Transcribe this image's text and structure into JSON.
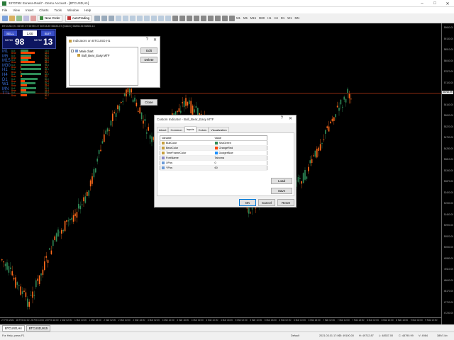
{
  "window": {
    "title": "3370795: Exness-Real7 - Demo Account - [BTCUSD,H1]"
  },
  "menu": [
    "File",
    "View",
    "Insert",
    "Charts",
    "Tools",
    "Window",
    "Help"
  ],
  "toolbar": {
    "new_order": "New Order",
    "autotrading": "AutoTrading",
    "timeframes": [
      "M1",
      "M5",
      "M15",
      "M30",
      "H1",
      "H4",
      "D1",
      "W1",
      "MN"
    ]
  },
  "chart": {
    "info": "BTCUSD,H1  56787.07 55789.27 56733.89 56833.67 (hidden) 56836.36 56806.13",
    "one_click": {
      "sell": "SELL",
      "buy": "BUY",
      "lot": "1.00",
      "sell_prefix": "56760",
      "sell_big": "98",
      "buy_prefix": "56762",
      "buy_big": "13"
    },
    "mtf": [
      {
        "tf": "M1",
        "bull": "35.0 %",
        "bear": "65.0 %"
      },
      {
        "tf": "M5",
        "bull": "50.0 %",
        "bear": "50.0 %"
      },
      {
        "tf": "M15",
        "bull": "35.0 %",
        "bear": "65.0 %"
      },
      {
        "tf": "M30",
        "bull": "95.4 %",
        "bear": "4.6 %"
      },
      {
        "tf": "H1",
        "bull": "96.1 %",
        "bear": "3.9 %"
      },
      {
        "tf": "H4",
        "bull": "95.0 %",
        "bear": "5.0 %"
      },
      {
        "tf": "D1",
        "bull": "80.0 %",
        "bear": "20.0 %"
      },
      {
        "tf": "W1",
        "bull": "70.4 %",
        "bear": "29.6 %"
      },
      {
        "tf": "MN",
        "bull": "73.6 %",
        "bear": "26.4 %"
      },
      {
        "tf": "TTL",
        "bull": "69.3 %",
        "bear": "30.7 %"
      }
    ],
    "bull_label": "Bull",
    "bear_label": "Bear",
    "price_labels": [
      "59660.00",
      "59130.00",
      "58510.00",
      "58040.00",
      "57570.00",
      "57100.00",
      "56630.00",
      "56160.00",
      "55690.00",
      "55220.00",
      "54750.00",
      "54280.00",
      "53810.00",
      "53340.00",
      "52870.00",
      "52400.00",
      "51930.00",
      "51460.00",
      "50990.00",
      "50520.00",
      "50050.00",
      "49580.00",
      "49110.00",
      "48640.00",
      "48170.00",
      "47700.00",
      "47230.00"
    ],
    "current_price": "56762.99",
    "time_labels": [
      "27 Feb 2021",
      "28 Feb 02:00",
      "28 Feb 10:00",
      "28 Feb 18:00",
      "1 Mar 02:00",
      "1 Mar 10:00",
      "1 Mar 18:00",
      "2 Mar 02:00",
      "2 Mar 10:00",
      "2 Mar 18:00",
      "3 Mar 02:00",
      "3 Mar 10:00",
      "3 Mar 18:00",
      "4 Mar 02:00",
      "4 Mar 10:00",
      "4 Mar 18:00",
      "5 Mar 02:00",
      "5 Mar 10:00",
      "5 Mar 18:00",
      "6 Mar 02:00",
      "6 Mar 10:00",
      "6 Mar 18:00",
      "7 Mar 02:00",
      "7 Mar 10:00",
      "7 Mar 18:00",
      "8 Mar 02:00",
      "8 Mar 10:00",
      "8 Mar 18:00",
      "9 Mar 02:00",
      "9 Mar 10:00"
    ]
  },
  "indicators_dialog": {
    "title": "Indicators on BTCUSD,H1",
    "tree": [
      "Main chart",
      "Bull_Bear_Easy MTF"
    ],
    "edit": "Edit",
    "delete": "Delete",
    "close": "Close"
  },
  "custom_dialog": {
    "title": "Custom Indicator - Bull_Bear_Easy MTF",
    "tabs": [
      "About",
      "Common",
      "Inputs",
      "Colors",
      "Visualization"
    ],
    "col_variable": "Variable",
    "col_value": "Value",
    "rows": [
      {
        "var": "BullColor",
        "val": "SeaGreen",
        "color": "#2e8b57"
      },
      {
        "var": "BearColor",
        "val": "OrangeRed",
        "color": "#ff4500"
      },
      {
        "var": "TimeFrameColor",
        "val": "DodgerBlue",
        "color": "#1e90ff"
      },
      {
        "var": "FontName",
        "val": "Tahoma",
        "color": ""
      },
      {
        "var": "XPos",
        "val": "0",
        "color": ""
      },
      {
        "var": "YPos",
        "val": "60",
        "color": ""
      }
    ],
    "load": "Load",
    "save": "Save",
    "ok": "OK",
    "cancel": "Cancel",
    "reset": "Reset"
  },
  "chart_tabs": [
    "BTCUSD,H4",
    "BTCUSD,M15"
  ],
  "status": {
    "help": "For Help, press F1",
    "profile": "Default",
    "time": "2021.03.01 17:00",
    "open": "O: 49100.00",
    "high": "H: 49712.87",
    "low": "L: 48537.00",
    "close": "C: 48790.99",
    "volume": "V: 4984",
    "traffic": "389/1 kb"
  }
}
